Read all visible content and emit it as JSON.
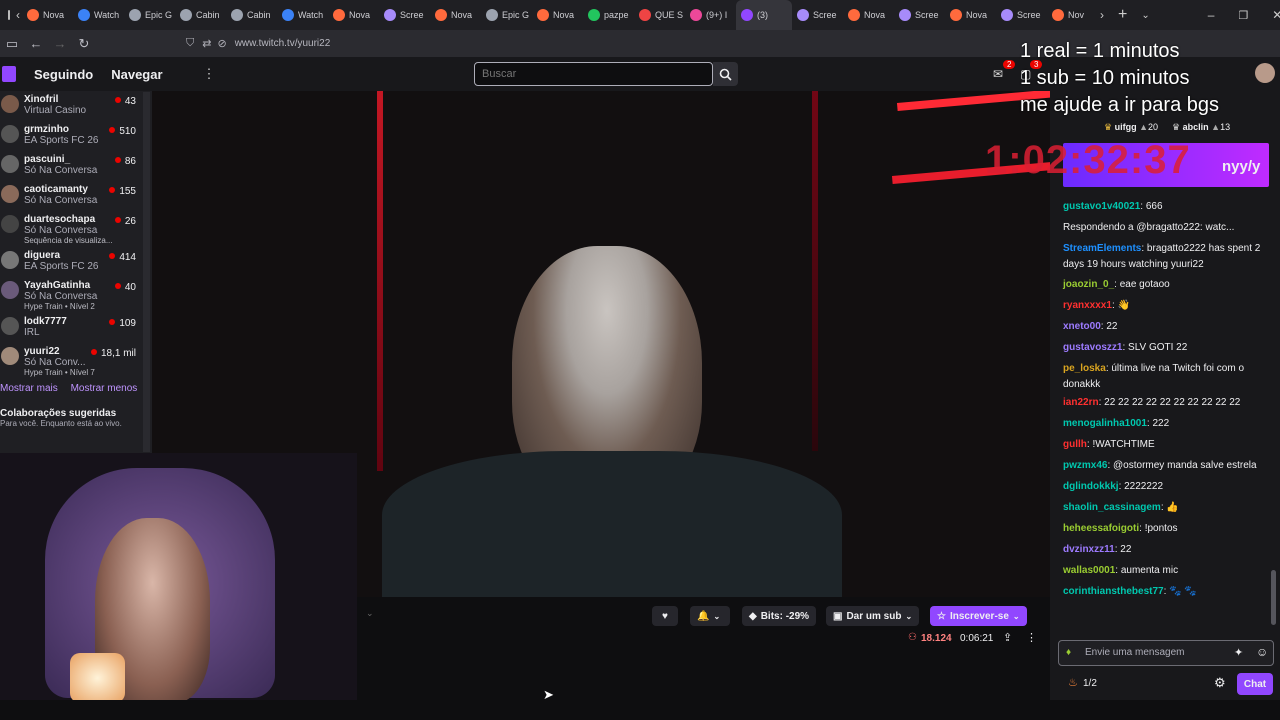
{
  "browser": {
    "tabs": [
      {
        "label": "Nova",
        "color": "#ff6a3d"
      },
      {
        "label": "Watch",
        "color": "#3b82f6"
      },
      {
        "label": "Epic G",
        "color": "#9ca3af"
      },
      {
        "label": "Cabin",
        "color": "#9ca3af"
      },
      {
        "label": "Cabin",
        "color": "#9ca3af"
      },
      {
        "label": "Watch",
        "color": "#3b82f6"
      },
      {
        "label": "Nova",
        "color": "#ff6a3d"
      },
      {
        "label": "Scree",
        "color": "#a78bfa"
      },
      {
        "label": "Nova",
        "color": "#ff6a3d"
      },
      {
        "label": "Epic G",
        "color": "#9ca3af"
      },
      {
        "label": "Nova",
        "color": "#ff6a3d"
      },
      {
        "label": "pazpe",
        "color": "#22c55e"
      },
      {
        "label": "QUE S",
        "color": "#ef4444"
      },
      {
        "label": "(9+) I",
        "color": "#ec4899"
      },
      {
        "label": "(3)",
        "color": "#9147ff",
        "active": true
      },
      {
        "label": "Scree",
        "color": "#a78bfa"
      },
      {
        "label": "Nova",
        "color": "#ff6a3d"
      },
      {
        "label": "Scree",
        "color": "#a78bfa"
      },
      {
        "label": "Nova",
        "color": "#ff6a3d"
      },
      {
        "label": "Scree",
        "color": "#a78bfa"
      },
      {
        "label": "Nov",
        "color": "#ff6a3d"
      }
    ],
    "url": "www.twitch.tv/yuuri22"
  },
  "topnav": {
    "following": "Seguindo",
    "browse": "Navegar",
    "search_placeholder": "Buscar",
    "notif_count": "2",
    "whisper_count": "3"
  },
  "overlay": {
    "line1": "1 real = 1 minutos",
    "line2": "1 sub = 10 minutos",
    "line3": "me ajude a ir para bgs",
    "timer": "1:02:32:37",
    "ticker": "nyy/y"
  },
  "sidebar": {
    "channels": [
      {
        "name": "Xinofril",
        "game": "Virtual Casino",
        "viewers": "43",
        "color": "#7a5a4a"
      },
      {
        "name": "grmzinho",
        "game": "EA Sports FC 26",
        "viewers": "510",
        "color": "#555"
      },
      {
        "name": "pascuini_",
        "game": "Só Na Conversa",
        "viewers": "86",
        "color": "#666"
      },
      {
        "name": "caoticamanty",
        "game": "Só Na Conversa",
        "viewers": "155",
        "color": "#8a6a5a"
      },
      {
        "name": "duartesochapa",
        "game": "Só Na Conversa",
        "extra": "Sequência de visualiza...",
        "viewers": "26",
        "color": "#444"
      },
      {
        "name": "diguera",
        "game": "EA Sports FC 26",
        "viewers": "414",
        "color": "#777"
      },
      {
        "name": "YayahGatinha",
        "game": "Só Na Conversa",
        "extra": "Hype Train • Nível 2",
        "viewers": "40",
        "color": "#6a5a7a"
      },
      {
        "name": "lodk7777",
        "game": "IRL",
        "viewers": "109",
        "color": "#555"
      },
      {
        "name": "yuuri22",
        "game": "Só Na Conv...",
        "extra": "Hype Train • Nível 7",
        "viewers": "18,1 mil",
        "color": "#a08a7a"
      }
    ],
    "show_more": "Mostrar mais",
    "show_less": "Mostrar menos",
    "collab_title": "Colaborações sugeridas",
    "collab_sub": "Para você. Enquanto está ao vivo."
  },
  "player": {
    "bits": "Bits: -29%",
    "gift": "Dar um sub",
    "subscribe": "Inscrever-se",
    "viewers": "18.124",
    "uptime": "0:06:21"
  },
  "chat": {
    "leaderboard": [
      {
        "name": "uifgg",
        "value": "20"
      },
      {
        "name": "abclin",
        "value": "13"
      }
    ],
    "messages": [
      {
        "user": "gustavo1v40021",
        "color": "#00c8af",
        "text": ": 666"
      },
      {
        "user": "",
        "color": "#adadb8",
        "text": "Respondendo a @bragatto222: watc..."
      },
      {
        "user": "StreamElements",
        "color": "#1e90ff",
        "text": ": bragatto2222 has spent 2 days 19 hours watching yuuri22"
      },
      {
        "user": "joaozin_0_",
        "color": "#9acd32",
        "text": ": eae gotaoo"
      },
      {
        "user": "ryanxxxx1",
        "color": "#ff3030",
        "text": ": 👋"
      },
      {
        "user": "xneto00",
        "color": "#9d7bff",
        "text": ": 22"
      },
      {
        "user": "gustavoszz1",
        "color": "#9d7bff",
        "text": ": SLV GOTI 22"
      },
      {
        "user": "pe_loska",
        "color": "#daa520",
        "text": ": última live na Twitch foi com o donakkk"
      },
      {
        "user": "ian22rn",
        "color": "#ff3030",
        "text": ": 22 22 22 22 22 22 22 22 22 22"
      },
      {
        "user": "menogalinha1001",
        "color": "#00c8af",
        "text": ": 222"
      },
      {
        "user": "gullh",
        "color": "#ff3030",
        "text": ": !WATCHTIME"
      },
      {
        "user": "pwzmx46",
        "color": "#00c8af",
        "text": ": @ostormey manda salve estrela"
      },
      {
        "user": "dglindokkkj",
        "color": "#00c8af",
        "text": ": 2222222"
      },
      {
        "user": "shaolin_cassinagem",
        "color": "#00c8af",
        "text": ": 👍"
      },
      {
        "user": "heheessafoigoti",
        "color": "#9acd32",
        "text": ": !pontos"
      },
      {
        "user": "dvzinxzz11",
        "color": "#9d7bff",
        "text": ": 22"
      },
      {
        "user": "wallas0001",
        "color": "#9acd32",
        "text": ": aumenta mic"
      },
      {
        "user": "corinthiansthebest77",
        "color": "#00c8af",
        "text": ": 🐾 🐾"
      }
    ],
    "input_placeholder": "Envie uma mensagem",
    "points": "1/2",
    "chat_button": "Chat"
  }
}
